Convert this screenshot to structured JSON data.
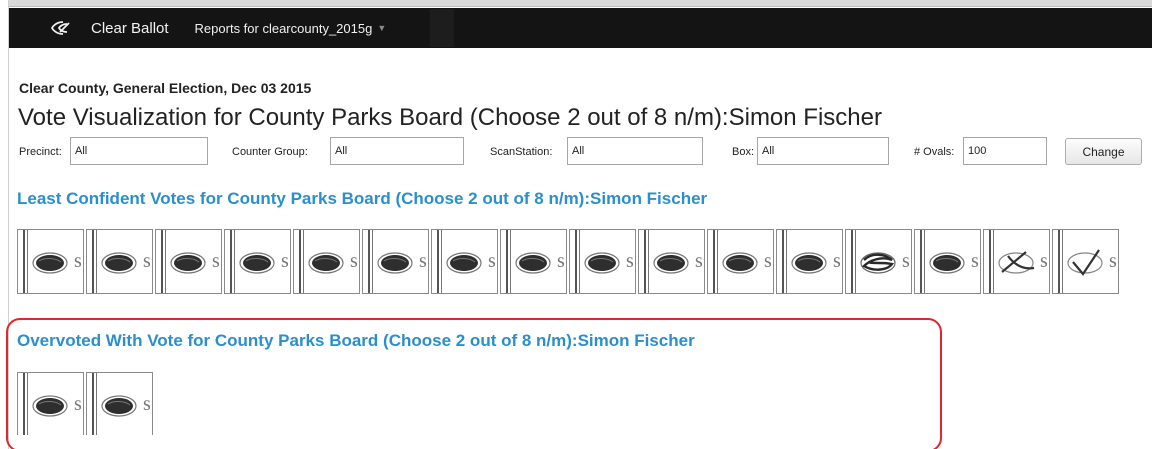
{
  "navbar": {
    "logo_icon": "clear-ballot-logo-icon",
    "brand": "Clear Ballot",
    "reports_menu": "Reports for clearcounty_2015g"
  },
  "header": {
    "subtitle": "Clear County, General Election, Dec 03 2015",
    "title": "Vote Visualization for County Parks Board (Choose 2 out of 8 n/m):Simon Fischer"
  },
  "filters": {
    "precinct": {
      "label": "Precinct:",
      "value": "All"
    },
    "counter_group": {
      "label": "Counter Group:",
      "value": "All"
    },
    "scan_station": {
      "label": "ScanStation:",
      "value": "All"
    },
    "box": {
      "label": "Box:",
      "value": "All"
    },
    "ovals": {
      "label": "# Ovals:",
      "value": "100"
    },
    "change_label": "Change"
  },
  "least_confident": {
    "heading": "Least Confident Votes for County Parks Board (Choose 2 out of 8 n/m):Simon Fischer",
    "marks": [
      "filled-oval",
      "filled-oval",
      "filled-oval",
      "filled-oval",
      "filled-oval",
      "filled-oval",
      "filled-oval",
      "filled-oval",
      "filled-oval",
      "filled-oval",
      "filled-oval",
      "filled-oval",
      "scribbled-oval",
      "filled-oval",
      "x-mark",
      "check-mark"
    ]
  },
  "overvoted": {
    "heading": "Overvoted With Vote for County Parks Board (Choose 2 out of 8 n/m):Simon Fischer",
    "marks": [
      "filled-oval",
      "filled-oval"
    ]
  },
  "colors": {
    "navbar": "#141414",
    "heading_blue": "#2b8fce",
    "highlight_red": "#e0262f"
  }
}
